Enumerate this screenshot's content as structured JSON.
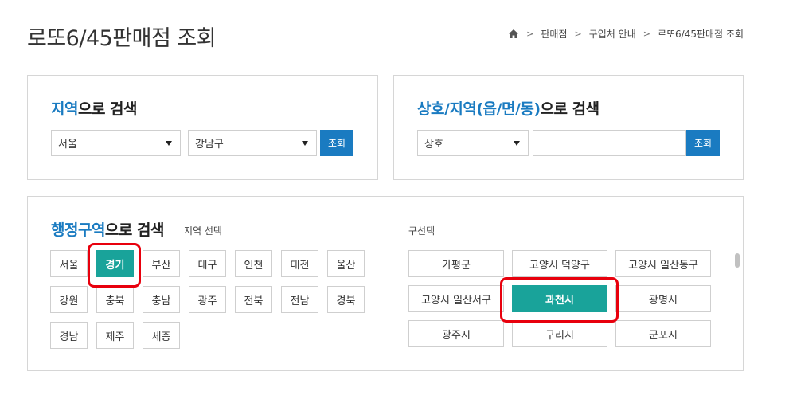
{
  "page": {
    "title": "로또6/45판매점 조회"
  },
  "breadcrumb": {
    "items": [
      "판매점",
      "구입처 안내",
      "로또6/45판매점 조회"
    ]
  },
  "region_search": {
    "title_accent": "지역",
    "title_rest": "으로 검색",
    "sido_value": "서울",
    "gugun_value": "강남구",
    "button_label": "조회"
  },
  "name_search": {
    "title_accent": "상호/지역(읍/면/동)",
    "title_rest": "으로 검색",
    "type_value": "상호",
    "keyword_value": "",
    "button_label": "조회"
  },
  "area_search": {
    "title_accent": "행정구역",
    "title_rest": "으로 검색",
    "region_hint": "지역 선택",
    "district_hint": "구선택",
    "regions": [
      "서울",
      "경기",
      "부산",
      "대구",
      "인천",
      "대전",
      "울산",
      "강원",
      "충북",
      "충남",
      "광주",
      "전북",
      "전남",
      "경북",
      "경남",
      "제주",
      "세종"
    ],
    "selected_region": "경기",
    "districts": [
      "가평군",
      "고양시 덕양구",
      "고양시 일산동구",
      "고양시 일산서구",
      "과천시",
      "광명시",
      "광주시",
      "구리시",
      "군포시"
    ],
    "selected_district": "과천시"
  },
  "colors": {
    "accent_blue": "#1a7bc1",
    "selected_teal": "#19a39a",
    "highlight_red": "#e8000d"
  }
}
